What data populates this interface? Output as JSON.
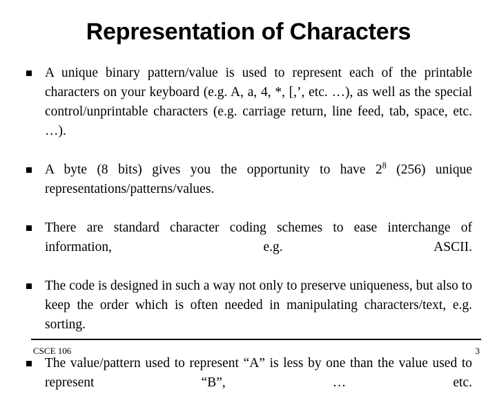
{
  "slide": {
    "title": "Representation of Characters",
    "bullets": [
      {
        "marker": "square-bullet",
        "text_before": "A unique binary pattern/value is used to represent each of the printable characters on your keyboard (e.g. A, a, 4, *, [,’, etc. …), as well as the special control/unprintable characters (e.g. carriage return, line feed, tab, space, etc. …).",
        "superscript": "",
        "text_after": ""
      },
      {
        "marker": "square-bullet",
        "text_before": "A byte (8 bits) gives you the opportunity to have 2",
        "superscript": "8",
        "text_after": " (256) unique representations/patterns/values."
      },
      {
        "marker": "square-bullet",
        "text_before": "There are standard character coding schemes to ease interchange of information, e.g. ASCII.",
        "superscript": "",
        "text_after": ""
      },
      {
        "marker": "square-bullet",
        "text_before": "The code is designed in such a way not only to preserve uniqueness, but also to keep the order which is often needed in manipulating characters/text, e.g. sorting.",
        "superscript": "",
        "text_after": ""
      },
      {
        "marker": "square-bullet",
        "text_before": "The value/pattern used to represent “A” is less by one than the value used to represent “B”, … etc.",
        "superscript": "",
        "text_after": ""
      }
    ]
  },
  "footer": {
    "course": "CSCE 106",
    "page_number": "3"
  },
  "colors": {
    "background": "#ffffff",
    "text": "#000000",
    "rule": "#000000"
  }
}
